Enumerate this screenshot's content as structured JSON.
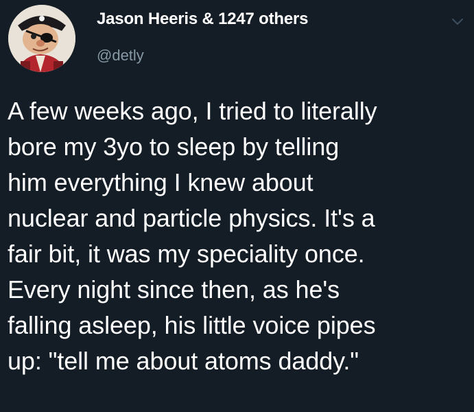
{
  "tweet": {
    "author": {
      "display_name": "Jason Heeris & 1247 others",
      "handle": "@detly"
    },
    "text_lines": [
      "A few weeks ago, I tried to literally",
      "bore my 3yo to sleep by telling",
      "him everything I knew about",
      "nuclear and particle physics. It's a",
      "fair bit, it was my speciality once.",
      "Every night since then, as he's",
      "falling asleep, his little voice pipes",
      "up: \"tell me about atoms daddy.\""
    ],
    "menu_icon": "chevron-down-icon",
    "avatar_icon": "pirate-puppet-avatar"
  },
  "colors": {
    "background": "#141d26",
    "text": "#ffffff",
    "secondary_text": "#8899a6"
  }
}
